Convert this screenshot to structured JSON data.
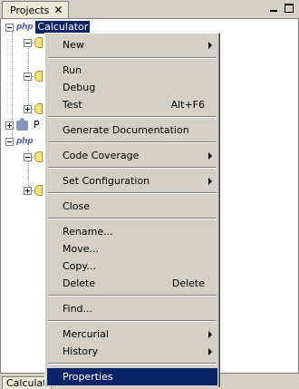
{
  "window": {
    "tab_title": "Projects",
    "close_glyph": "✕",
    "bottom_tab_label": "Calculat"
  },
  "tree": {
    "nodes": [
      {
        "label": "Calculator",
        "icon": "php-icon",
        "selected": true
      },
      {
        "label": "P",
        "icon": "puzzle-icon"
      },
      {
        "label": "",
        "icon": "php-icon"
      }
    ],
    "php_glyph": "php"
  },
  "context_menu": {
    "items": [
      {
        "label": "New",
        "submenu": true
      },
      {
        "label": "Run"
      },
      {
        "label": "Debug"
      },
      {
        "label": "Test",
        "shortcut": "Alt+F6"
      },
      {
        "label": "Generate Documentation"
      },
      {
        "label": "Code Coverage",
        "submenu": true
      },
      {
        "label": "Set Configuration",
        "submenu": true
      },
      {
        "label": "Close"
      },
      {
        "label": "Rename..."
      },
      {
        "label": "Move..."
      },
      {
        "label": "Copy..."
      },
      {
        "label": "Delete",
        "shortcut": "Delete"
      },
      {
        "label": "Find..."
      },
      {
        "label": "Mercurial",
        "submenu": true
      },
      {
        "label": "History",
        "submenu": true
      },
      {
        "label": "Properties",
        "highlighted": true
      }
    ]
  },
  "colors": {
    "selection": "#0a246a",
    "menu_bg": "#d4d0c8",
    "tree_bg": "#ffffff"
  }
}
